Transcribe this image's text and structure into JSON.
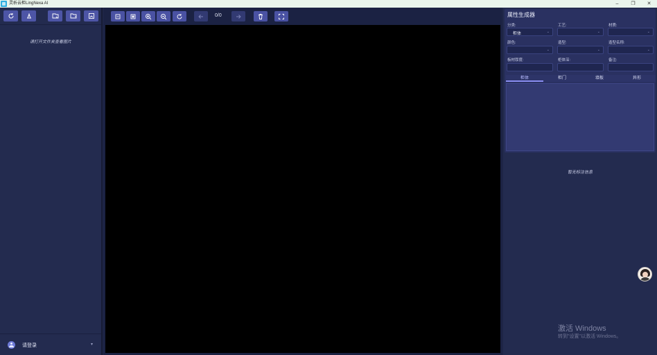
{
  "window": {
    "title": "灵析云柜LingNexa AI",
    "controls": {
      "minimize": "–",
      "restore": "❐",
      "close": "✕"
    }
  },
  "left_panel": {
    "toolbar_icons": [
      "refresh-icon",
      "clear-icon",
      "open-file-icon",
      "open-folder-icon",
      "image-select-icon"
    ],
    "empty_message": "请打开文件夹查看图片",
    "login": {
      "label": "请登录",
      "caret": "▾"
    }
  },
  "center_panel": {
    "toolbar_icons": [
      "fit-width-icon",
      "fit-page-icon",
      "zoom-in-icon",
      "zoom-out-icon",
      "rotate-icon",
      "prev-arrow-icon",
      "next-arrow-icon",
      "delete-icon",
      "fullscreen-icon"
    ],
    "page_indicator": "0/0"
  },
  "right_panel": {
    "title": "属性生成器",
    "fields": {
      "category": {
        "label": "分类:",
        "value": "柜体"
      },
      "craft": {
        "label": "工艺:",
        "value": ""
      },
      "material": {
        "label": "材质:",
        "value": ""
      },
      "color": {
        "label": "颜色:",
        "value": ""
      },
      "shape": {
        "label": "造型:",
        "value": ""
      },
      "shape_name": {
        "label": "造型名称:",
        "value": ""
      },
      "board_thickness": {
        "label": "板材厚度:",
        "value": ""
      },
      "cabinet_depth": {
        "label": "柜体深:",
        "value": ""
      },
      "remark": {
        "label": "备注:",
        "value": ""
      }
    },
    "tabs": [
      {
        "label": "柜体",
        "active": true
      },
      {
        "label": "柜门",
        "active": false
      },
      {
        "label": "填板",
        "active": false
      },
      {
        "label": "异形",
        "active": false
      }
    ],
    "no_annotation": "暂无标注信息"
  },
  "watermark": {
    "title": "激活 Windows",
    "subtitle": "转到\"设置\"以激活 Windows。"
  },
  "colors": {
    "accent": "#4d55a6",
    "background": "#1e2546",
    "canvas": "#000000"
  }
}
